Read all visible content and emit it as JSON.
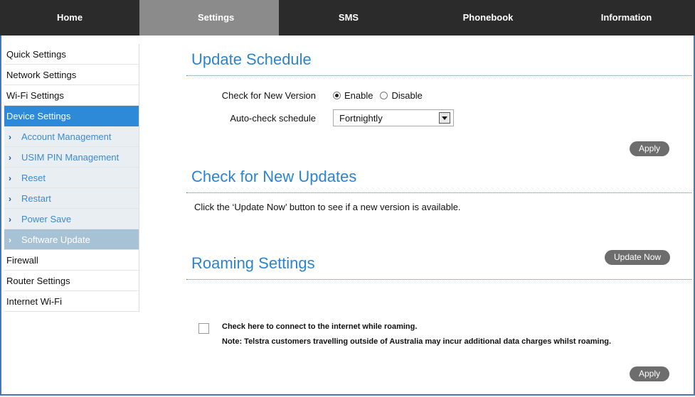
{
  "nav": {
    "tabs": [
      {
        "label": "Home"
      },
      {
        "label": "Settings"
      },
      {
        "label": "SMS"
      },
      {
        "label": "Phonebook"
      },
      {
        "label": "Information"
      }
    ],
    "active": "Settings"
  },
  "sidebar": {
    "items": [
      {
        "label": "Quick Settings"
      },
      {
        "label": "Network Settings"
      },
      {
        "label": "Wi-Fi Settings"
      },
      {
        "label": "Device Settings"
      },
      {
        "label": "Account Management"
      },
      {
        "label": "USIM PIN Management"
      },
      {
        "label": "Reset"
      },
      {
        "label": "Restart"
      },
      {
        "label": "Power Save"
      },
      {
        "label": "Software Update"
      },
      {
        "label": "Firewall"
      },
      {
        "label": "Router Settings"
      },
      {
        "label": "Internet Wi-Fi"
      }
    ]
  },
  "update_schedule": {
    "title": "Update Schedule",
    "check_label": "Check for New Version",
    "enable_label": "Enable",
    "disable_label": "Disable",
    "selected": "Enable",
    "auto_label": "Auto-check schedule",
    "auto_value": "Fortnightly",
    "apply_label": "Apply"
  },
  "check_updates": {
    "title": "Check for New Updates",
    "text": "Click the ‘Update Now’ button to see if a new version is available.",
    "button_label": "Update Now"
  },
  "roaming": {
    "title": "Roaming Settings",
    "checkbox_label": "Check here to connect to the internet while roaming.",
    "note": "Note: Telstra customers travelling outside of Australia may incur additional data charges whilst roaming.",
    "checked": false,
    "apply_label": "Apply"
  },
  "colors": {
    "accent": "#2d8ad8",
    "nav_bg": "#2b2b2b",
    "nav_active": "#8b8b8b",
    "button": "#6d6d6d"
  }
}
